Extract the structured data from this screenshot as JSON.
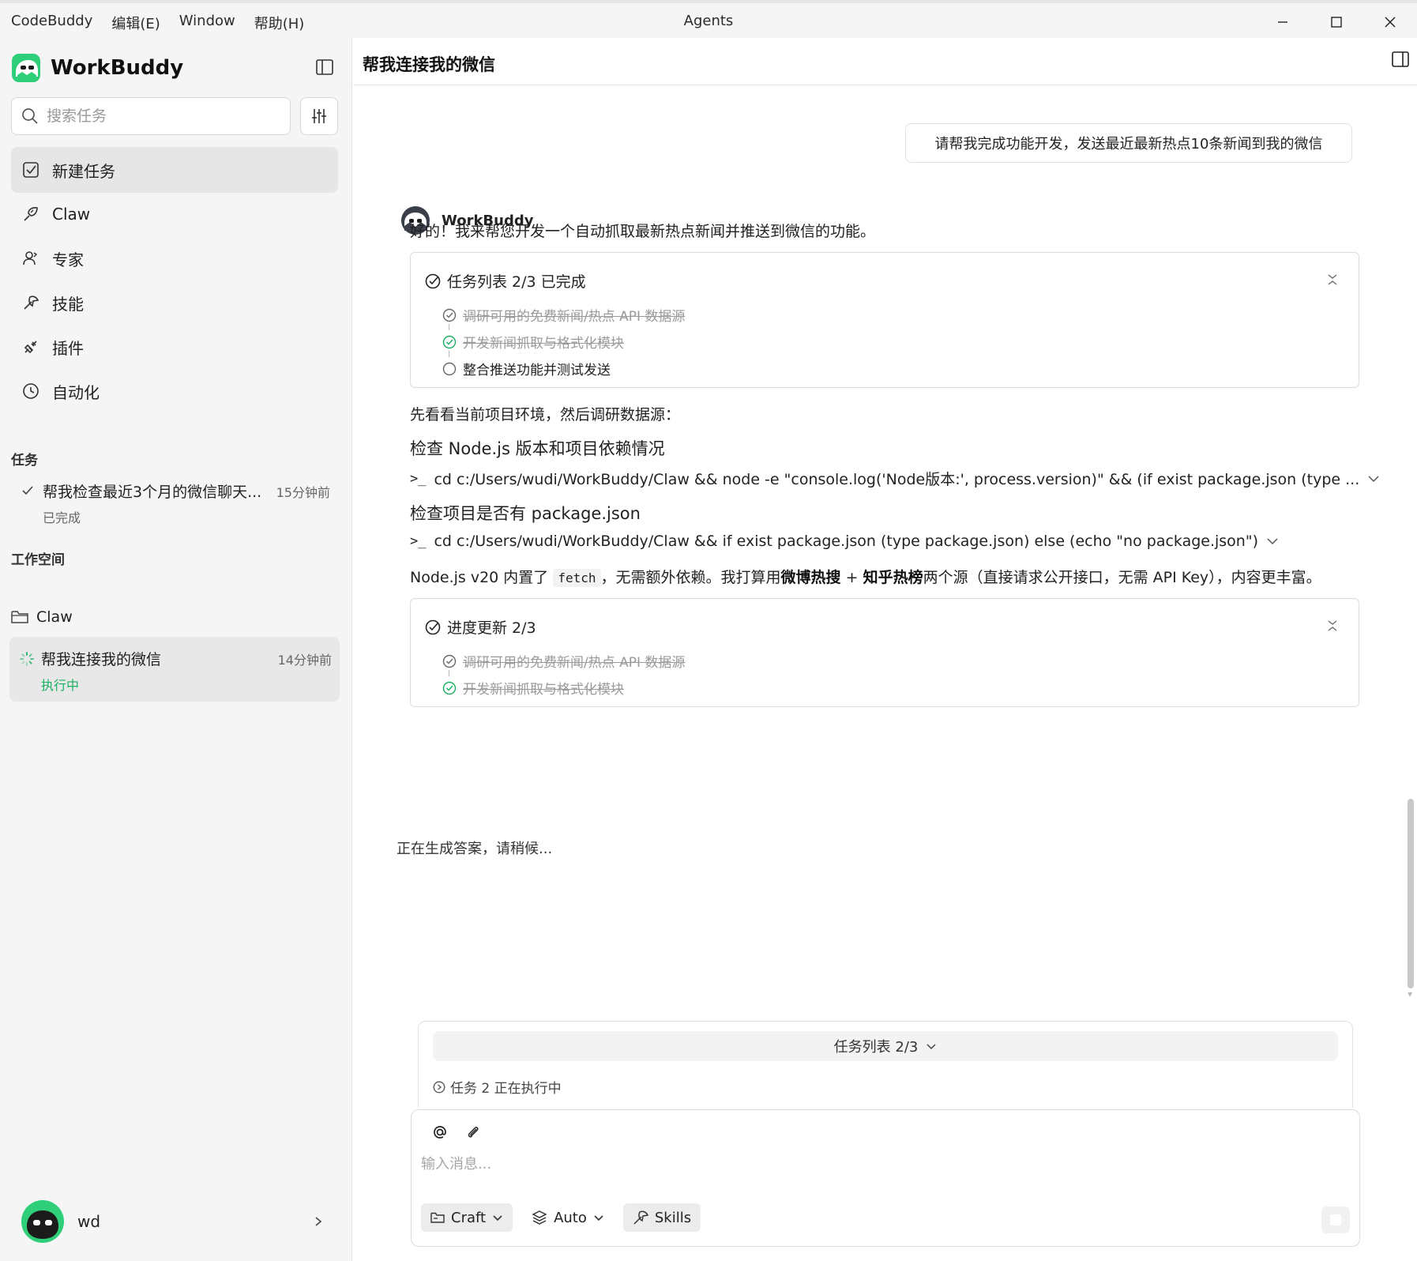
{
  "menubar": {
    "items": [
      "CodeBuddy",
      "编辑(E)",
      "Window",
      "帮助(H)"
    ],
    "window_title": "Agents"
  },
  "sidebar": {
    "brand": "WorkBuddy",
    "search_placeholder": "搜索任务",
    "nav": [
      {
        "label": "新建任务",
        "icon": "new-task-icon"
      },
      {
        "label": "Claw",
        "icon": "claw-icon"
      },
      {
        "label": "专家",
        "icon": "experts-icon"
      },
      {
        "label": "技能",
        "icon": "skills-icon"
      },
      {
        "label": "插件",
        "icon": "plugin-icon"
      },
      {
        "label": "自动化",
        "icon": "clock-icon"
      }
    ],
    "tasks_label": "任务",
    "tasks": [
      {
        "title": "帮我检查最近3个月的微信聊天...",
        "time": "15分钟前",
        "status": "已完成"
      }
    ],
    "workspace_label": "工作空间",
    "workspace_folder": "Claw",
    "workspace_tasks": [
      {
        "title": "帮我连接我的微信",
        "time": "14分钟前",
        "status": "执行中"
      }
    ],
    "user": "wd"
  },
  "main": {
    "title": "帮我连接我的微信",
    "user_message": "请帮我完成功能开发，发送最近最新热点10条新闻到我的微信",
    "assistant_name": "WorkBuddy",
    "intro": "好的！我来帮您开发一个自动抓取最新热点新闻并推送到微信的功能。",
    "task_card": {
      "title": "任务列表 2/3 已完成",
      "items": [
        {
          "text": "调研可用的免费新闻/热点 API 数据源",
          "state": "done"
        },
        {
          "text": "开发新闻抓取与格式化模块",
          "state": "done"
        },
        {
          "text": "整合推送功能并测试发送",
          "state": "pending"
        }
      ]
    },
    "para_env": "先看看当前项目环境，然后调研数据源：",
    "step1_title": "检查 Node.js 版本和项目依赖情况",
    "cmd1": "cd c:/Users/wudi/WorkBuddy/Claw && node -e \"console.log('Node版本:', process.version)\" && (if exist package.json (type ...",
    "step2_title": "检查项目是否有 package.json",
    "cmd2": "cd c:/Users/wudi/WorkBuddy/Claw && if exist package.json (type package.json) else (echo \"no package.json\")",
    "para_node": {
      "a": "Node.js v20 内置了 ",
      "code": "fetch",
      "b": "，无需额外依赖。我打算用",
      "bold1": "微博热搜",
      "c": " + ",
      "bold2": "知乎热榜",
      "d": "两个源（直接请求公开接口，无需 API Key），内容更丰富。"
    },
    "progress_card": {
      "title": "进度更新 2/3",
      "items": [
        {
          "text": "调研可用的免费新闻/热点 API 数据源",
          "state": "done"
        },
        {
          "text": "开发新闻抓取与格式化模块",
          "state": "done"
        }
      ]
    },
    "generating": "正在生成答案，请稍候..."
  },
  "composer": {
    "tasklist_toggle": "任务列表 2/3",
    "tasklist_status": "任务 2 正在执行中",
    "placeholder": "输入消息...",
    "mode": "Craft",
    "model": "Auto",
    "skills": "Skills"
  },
  "colors": {
    "accent_green": "#18b060",
    "sidebar_bg": "#f5f5f5"
  }
}
